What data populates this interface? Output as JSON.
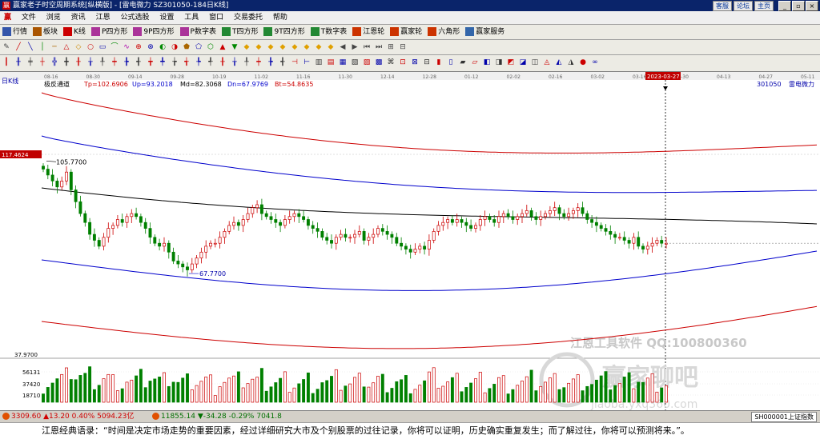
{
  "window": {
    "app_icon": "赢",
    "title": "赢家老子时空周期系统[纵横版] - [雷电微力  SZ301050-184日K线]",
    "links": [
      "客服",
      "论坛",
      "主页"
    ],
    "buttons": [
      "_",
      "▫",
      "×"
    ]
  },
  "menu": {
    "icon": "赢",
    "items": [
      "文件",
      "浏览",
      "资讯",
      "江恩",
      "公式选股",
      "设置",
      "工具",
      "窗口",
      "交易委托",
      "帮助"
    ]
  },
  "toolbar1": [
    {
      "label": "行情",
      "color": "#3355aa"
    },
    {
      "label": "板块",
      "color": "#aa5500"
    },
    {
      "label": "K线",
      "color": "#cc0000"
    },
    {
      "label": "P四方形",
      "color": "#aa3399"
    },
    {
      "label": "9P四方形",
      "color": "#aa3399"
    },
    {
      "label": "P数字表",
      "color": "#aa3399"
    },
    {
      "label": "T四方形",
      "color": "#228833"
    },
    {
      "label": "9T四方形",
      "color": "#228833"
    },
    {
      "label": "T数字表",
      "color": "#228833"
    },
    {
      "label": "江恩轮",
      "color": "#cc3300"
    },
    {
      "label": "赢家轮",
      "color": "#cc3300"
    },
    {
      "label": "六角形",
      "color": "#cc3300"
    },
    {
      "label": "赢家服务",
      "color": "#3366aa"
    }
  ],
  "chart": {
    "period_label": "日K线",
    "indicator_name": "极反通道",
    "tp_label": "Tp=102.6906",
    "up_label": "Up=93.2018",
    "md_label": "Md=82.3068",
    "dn_label": "Dn=67.9769",
    "bt_label": "Bt=54.8635",
    "code_label": "301050",
    "name_label": "雷电微力",
    "price_marker": "117.4624",
    "high_annot": "105.7700",
    "low_annot": "67.7700",
    "price_floor_label": "37.9700",
    "cursor_date": "2023-03-27",
    "volume_ticks": [
      "56131",
      "37420",
      "18710"
    ],
    "watermark_line1": "江恩工具软件   QQ:100800360",
    "watermark_line2": "赢家聊吧",
    "watermark_line3": "jiaoba.yxq360.com",
    "dates": [
      "08-16",
      "08-30",
      "09-14",
      "09-28",
      "10-19",
      "11-02",
      "11-16",
      "11-30",
      "12-14",
      "12-28",
      "01-12",
      "02-02",
      "02-16",
      "03-02",
      "03-16",
      "03-30",
      "04-13",
      "04-27",
      "05-11"
    ]
  },
  "chart_data": {
    "type": "candlestick",
    "title": "",
    "price_axis_marks": [
      117.4624,
      37.97
    ],
    "channel_params": {
      "Tp": 102.6906,
      "Up": 93.2018,
      "Md": 82.3068,
      "Dn": 67.9769,
      "Bt": 54.8635
    },
    "high": 105.77,
    "low": 67.77,
    "cursor_date": "2023-03-27",
    "closes": [
      103,
      101,
      99,
      97,
      99,
      102,
      96,
      92,
      88,
      85,
      81,
      79,
      77,
      80,
      83,
      84,
      86,
      85,
      87,
      88,
      87,
      85,
      83,
      80,
      78,
      77,
      78,
      75,
      72,
      71,
      70,
      69,
      71,
      73,
      75,
      77,
      78,
      78,
      80,
      82,
      84,
      85,
      84,
      86,
      88,
      90,
      91,
      88,
      87,
      86,
      85,
      84,
      86,
      87,
      88,
      87,
      86,
      84,
      83,
      82,
      80,
      79,
      78,
      80,
      81,
      80,
      80,
      81,
      82,
      79,
      80,
      81,
      83,
      82,
      81,
      80,
      78,
      77,
      76,
      75,
      76,
      77,
      76,
      79,
      82,
      84,
      85,
      86,
      85,
      86,
      85,
      84,
      83,
      84,
      86,
      87,
      86,
      85,
      87,
      88,
      87,
      86,
      87,
      88,
      89,
      87,
      86,
      87,
      88,
      89,
      90,
      88,
      87,
      88,
      89,
      90,
      88,
      86,
      85,
      84,
      83,
      82,
      81,
      80,
      80,
      79,
      78,
      80,
      77,
      76,
      77,
      78,
      79,
      78,
      78
    ],
    "volume_axis_ticks": [
      56131,
      37420,
      18710
    ],
    "channel_lines": [
      "Tp",
      "Up",
      "Md",
      "Dn",
      "Bt"
    ],
    "colors": {
      "up_candle": "#cc0000",
      "down_candle": "#008000",
      "tp": "#cc0000",
      "up": "#0000cc",
      "md": "#000000",
      "dn": "#0000cc",
      "bt": "#cc0000"
    }
  },
  "status": {
    "sh_index": "3309.60",
    "sh_change": "▲13.20",
    "sh_pct": "0.40%",
    "sh_amount": "5094.23亿",
    "sz_index": "11855.14",
    "sz_change": "▼-34.28",
    "sz_pct": "-0.29%",
    "sz_amount": "7041.8",
    "ticker": "SH000001上证指数"
  },
  "quote": "江恩经典语录：“时间是决定市场走势的重要因素，经过详细研究大市及个别股票的过往记录，你将可以证明，历史确实重复发生；而了解过往，你将可以预测将来。”。"
}
